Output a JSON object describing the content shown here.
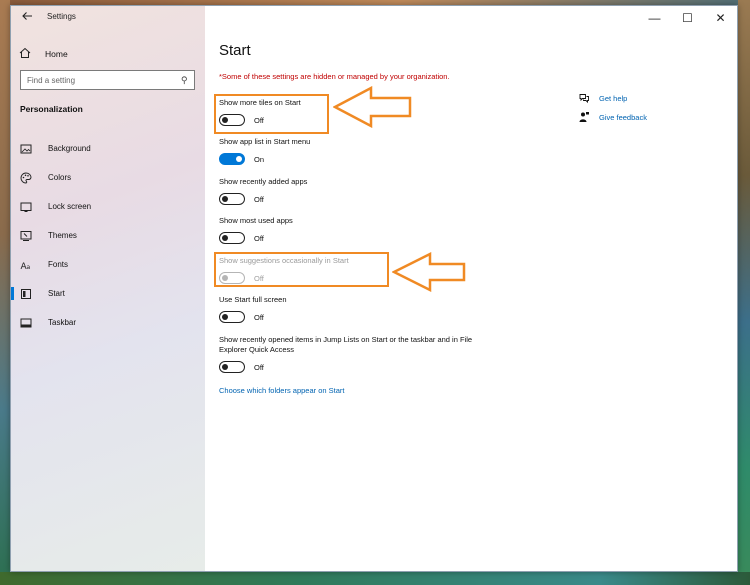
{
  "window": {
    "title": "Settings",
    "back_icon": "back-arrow-icon",
    "controls": {
      "minimize": "—",
      "maximize": "☐",
      "close": "✕"
    }
  },
  "sidebar": {
    "home_label": "Home",
    "search_placeholder": "Find a setting",
    "section_heading": "Personalization",
    "items": [
      {
        "label": "Background",
        "icon": "picture-icon",
        "active": false
      },
      {
        "label": "Colors",
        "icon": "palette-icon",
        "active": false
      },
      {
        "label": "Lock screen",
        "icon": "lock-screen-icon",
        "active": false
      },
      {
        "label": "Themes",
        "icon": "themes-icon",
        "active": false
      },
      {
        "label": "Fonts",
        "icon": "font-icon",
        "active": false
      },
      {
        "label": "Start",
        "icon": "start-icon",
        "active": true
      },
      {
        "label": "Taskbar",
        "icon": "taskbar-icon",
        "active": false
      }
    ]
  },
  "content": {
    "title": "Start",
    "org_message": "*Some of these settings are hidden or managed by your organization.",
    "settings": [
      {
        "label": "Show more tiles on Start",
        "state": "Off",
        "on": false,
        "disabled": false
      },
      {
        "label": "Show app list in Start menu",
        "state": "On",
        "on": true,
        "disabled": false
      },
      {
        "label": "Show recently added apps",
        "state": "Off",
        "on": false,
        "disabled": false
      },
      {
        "label": "Show most used apps",
        "state": "Off",
        "on": false,
        "disabled": false
      },
      {
        "label": "Show suggestions occasionally in Start",
        "state": "Off",
        "on": false,
        "disabled": true
      },
      {
        "label": "Use Start full screen",
        "state": "Off",
        "on": false,
        "disabled": false
      },
      {
        "label": "Show recently opened items in Jump Lists on Start or the taskbar and in File Explorer Quick Access",
        "state": "Off",
        "on": false,
        "disabled": false
      }
    ],
    "folders_link": "Choose which folders appear on Start",
    "help": {
      "get_help": "Get help",
      "give_feedback": "Give feedback"
    }
  },
  "colors": {
    "accent": "#0078d7",
    "link": "#0063b1",
    "warning": "#c00000",
    "annotation": "#f08a24"
  }
}
